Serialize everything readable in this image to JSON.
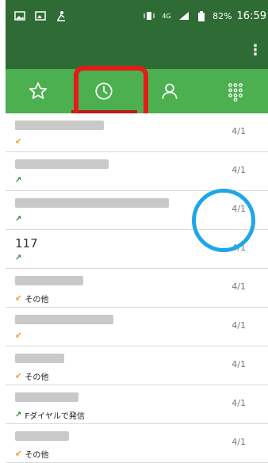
{
  "status_bar": {
    "battery_percent": "82%",
    "time": "16:59",
    "network": "4G"
  },
  "toolbar": {
    "overflow_label": "⋮"
  },
  "tabs": [
    {
      "icon": "star-icon"
    },
    {
      "icon": "clock-icon",
      "selected": true
    },
    {
      "icon": "person-icon"
    },
    {
      "icon": "dialpad-icon"
    }
  ],
  "calls": [
    {
      "name": "",
      "type": "incoming",
      "note": "",
      "date": "4/1"
    },
    {
      "name": "",
      "type": "outgoing",
      "note": "",
      "date": "4/1"
    },
    {
      "name": "",
      "type": "outgoing",
      "note": "",
      "date": "4/1"
    },
    {
      "name": "117",
      "type": "outgoing",
      "note": "",
      "date": "4/1"
    },
    {
      "name": "",
      "type": "incoming",
      "note": "その他",
      "date": "4/1"
    },
    {
      "name": "",
      "type": "incoming",
      "note": "",
      "date": "4/1"
    },
    {
      "name": "",
      "type": "incoming",
      "note": "その他",
      "date": "4/1"
    },
    {
      "name": "",
      "type": "outgoing",
      "note": "Fダイヤルで発信",
      "date": "4/1"
    },
    {
      "name": "",
      "type": "incoming",
      "note": "その他",
      "date": "4/1"
    }
  ]
}
